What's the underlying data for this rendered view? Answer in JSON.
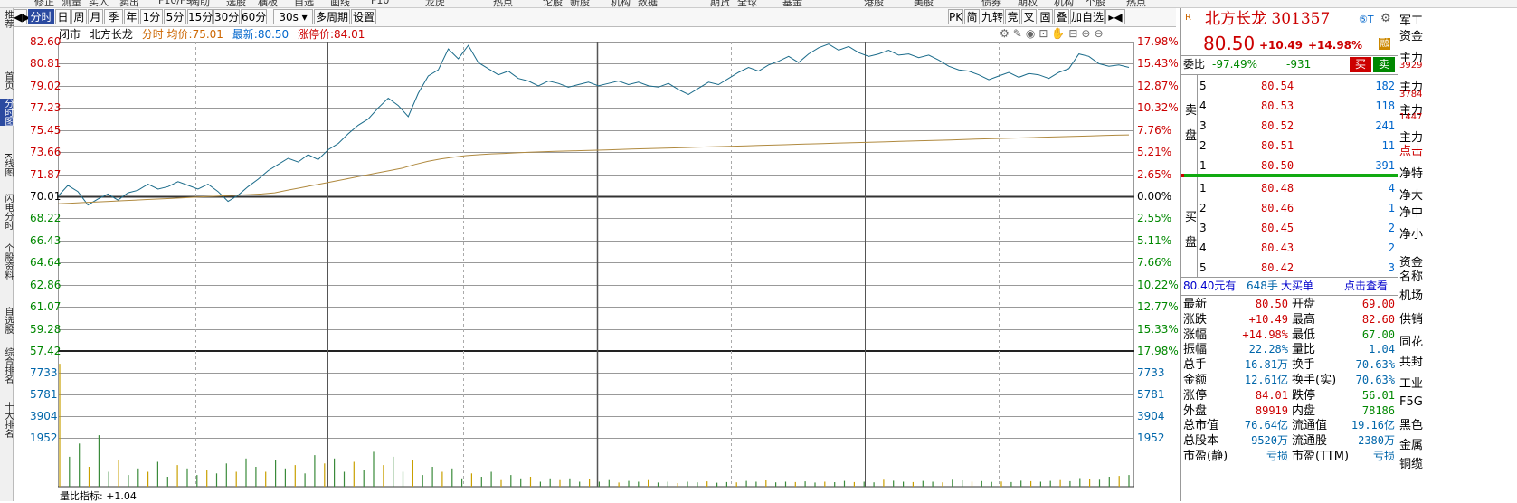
{
  "top_menu": [
    "修正",
    "测量",
    "买入",
    "卖出",
    "F10/F9",
    "陶助",
    "选股",
    "横板",
    "自选",
    "画线",
    "F10",
    "龙虎",
    "热点",
    "论股",
    "新股",
    "机构",
    "数据",
    "期货",
    "全球",
    "基金",
    "港股",
    "美股",
    "债券",
    "期权",
    "机构",
    "个股",
    "热点"
  ],
  "toolbar": {
    "tabs": [
      "分时",
      "日",
      "周",
      "月",
      "季",
      "年",
      "1分",
      "5分",
      "15分",
      "30分",
      "60分",
      "30s",
      "多周期",
      "设置"
    ],
    "right_buttons": [
      "PK",
      "简",
      "九转",
      "竞",
      "叉",
      "固",
      "叠",
      "加自选"
    ]
  },
  "sidebar": [
    "推荐",
    "首页",
    "分时图",
    "K线图",
    "闪电分时",
    "个股资料",
    "自选股",
    "综合排名",
    "十大排名"
  ],
  "chart_info": {
    "status": "闭市",
    "name": "北方长龙",
    "mode": "分时",
    "avg_label": "均价:",
    "avg_value": "75.01",
    "latest_label": "最新:",
    "latest_value": "80.50",
    "limit_label": "涨停价:",
    "limit_value": "84.01"
  },
  "price_axis_left": [
    "82.60",
    "80.81",
    "79.02",
    "77.23",
    "75.45",
    "73.66",
    "71.87",
    "70.01",
    "68.22",
    "66.43",
    "64.64",
    "62.86",
    "61.07",
    "59.28",
    "57.42"
  ],
  "price_axis_right": [
    "17.98%",
    "15.43%",
    "12.87%",
    "10.32%",
    "7.76%",
    "5.21%",
    "2.65%",
    "0.00%",
    "2.55%",
    "5.11%",
    "7.66%",
    "10.22%",
    "12.77%",
    "15.33%",
    "17.98%"
  ],
  "volume_axis_left": [
    "7733",
    "5781",
    "3904",
    "1952"
  ],
  "volume_axis_right": [
    "7733",
    "5781",
    "3904",
    "1952"
  ],
  "bottom_label": "量比指标: +1.04",
  "chart_data": {
    "type": "line",
    "y_range": [
      57.42,
      82.6
    ],
    "prev_close": 70.01,
    "price_series": [
      70.01,
      70.9,
      70.4,
      69.3,
      69.8,
      70.2,
      69.7,
      70.3,
      70.5,
      71.0,
      70.6,
      70.8,
      71.2,
      70.9,
      70.6,
      71.0,
      70.4,
      69.6,
      70.1,
      70.8,
      71.4,
      72.1,
      72.6,
      73.1,
      72.8,
      73.4,
      73.0,
      73.8,
      74.3,
      75.1,
      75.8,
      76.3,
      77.2,
      78.0,
      77.4,
      76.5,
      78.4,
      79.8,
      80.3,
      82.0,
      81.2,
      82.3,
      80.9,
      80.4,
      79.9,
      80.2,
      79.6,
      79.4,
      79.0,
      79.4,
      79.2,
      78.9,
      79.1,
      79.3,
      79.0,
      79.2,
      79.4,
      79.1,
      79.3,
      79.0,
      78.9,
      79.2,
      78.7,
      78.3,
      78.8,
      79.3,
      79.1,
      79.6,
      80.1,
      80.5,
      80.2,
      80.7,
      81.0,
      81.4,
      80.9,
      81.6,
      82.1,
      82.4,
      81.9,
      82.2,
      81.7,
      81.4,
      81.6,
      81.9,
      81.5,
      81.6,
      81.3,
      81.5,
      81.1,
      80.6,
      80.3,
      80.2,
      79.9,
      79.5,
      79.8,
      80.1,
      79.7,
      80.0,
      79.9,
      79.6,
      80.1,
      80.4,
      81.6,
      81.4,
      80.8,
      80.6,
      80.7,
      80.5
    ],
    "avg_series": [
      69.4,
      69.45,
      69.5,
      69.55,
      69.6,
      69.65,
      69.7,
      69.75,
      69.8,
      69.85,
      69.9,
      69.95,
      70.0,
      70.05,
      70.1,
      70.15,
      70.2,
      70.3,
      70.5,
      70.7,
      70.9,
      71.1,
      71.3,
      71.5,
      71.7,
      71.9,
      72.1,
      72.3,
      72.6,
      72.85,
      73.05,
      73.2,
      73.32,
      73.4,
      73.46,
      73.5,
      73.55,
      73.6,
      73.64,
      73.67,
      73.7,
      73.73,
      73.76,
      73.79,
      73.82,
      73.85,
      73.88,
      73.91,
      73.94,
      73.97,
      74.0,
      74.03,
      74.06,
      74.09,
      74.12,
      74.15,
      74.18,
      74.21,
      74.24,
      74.27,
      74.3,
      74.33,
      74.36,
      74.39,
      74.42,
      74.45,
      74.48,
      74.51,
      74.54,
      74.57,
      74.6,
      74.63,
      74.66,
      74.69,
      74.72,
      74.75,
      74.78,
      74.81,
      74.84,
      74.87,
      74.9,
      74.93,
      74.96,
      74.99,
      75.01
    ],
    "volume_range": [
      0,
      7733
    ],
    "volume_series": [
      7400,
      1800,
      2600,
      1200,
      3100,
      900,
      1600,
      700,
      1100,
      900,
      1500,
      600,
      1300,
      1100,
      700,
      1000,
      800,
      1400,
      900,
      1700,
      1200,
      900,
      1600,
      1100,
      1300,
      800,
      1900,
      1400,
      1700,
      900,
      1500,
      1000,
      2100,
      1300,
      1800,
      900,
      1600,
      700,
      1200,
      900,
      1100,
      500,
      800,
      600,
      900,
      400,
      700,
      500,
      600,
      300,
      500,
      400,
      500,
      300,
      450,
      300,
      400,
      250,
      350,
      300,
      400,
      250,
      300,
      220,
      300,
      260,
      320,
      240,
      280,
      260,
      350,
      300,
      380,
      260,
      300,
      280,
      320,
      250,
      300,
      270,
      350,
      280,
      300,
      260,
      420,
      360,
      300,
      280,
      350,
      300,
      260,
      420,
      380,
      300,
      340,
      290,
      310,
      280,
      360,
      330,
      300,
      350,
      400,
      330,
      520,
      480,
      420,
      600,
      650,
      700
    ]
  },
  "right_panel": {
    "stock_name": "北方长龙",
    "stock_code": "301357",
    "price": "80.50",
    "change": "+10.49",
    "change_pct": "+14.98%",
    "weibi_label": "委比",
    "weibi_value": "-97.49%",
    "weicha": "-931",
    "buy_btn": "买",
    "sell_btn": "卖",
    "sell_label": "卖盘",
    "buy_label": "买盘",
    "asks": [
      {
        "level": "5",
        "price": "80.54",
        "vol": "182"
      },
      {
        "level": "4",
        "price": "80.53",
        "vol": "118"
      },
      {
        "level": "3",
        "price": "80.52",
        "vol": "241"
      },
      {
        "level": "2",
        "price": "80.51",
        "vol": "11"
      },
      {
        "level": "1",
        "price": "80.50",
        "vol": "391"
      }
    ],
    "bids": [
      {
        "level": "1",
        "price": "80.48",
        "vol": "4"
      },
      {
        "level": "2",
        "price": "80.46",
        "vol": "1"
      },
      {
        "level": "3",
        "price": "80.45",
        "vol": "2"
      },
      {
        "level": "4",
        "price": "80.43",
        "vol": "2"
      },
      {
        "level": "5",
        "price": "80.42",
        "vol": "3"
      }
    ],
    "big_order_price": "80.40元有",
    "big_order_vol": "648手",
    "big_order_text": "大买单",
    "big_order_link": "点击查看",
    "stats": [
      {
        "l": "最新",
        "v": "80.50",
        "l2": "开盘",
        "v2": "69.00"
      },
      {
        "l": "涨跌",
        "v": "+10.49",
        "l2": "最高",
        "v2": "82.60"
      },
      {
        "l": "涨幅",
        "v": "+14.98%",
        "l2": "最低",
        "v2": "67.00"
      },
      {
        "l": "振幅",
        "v": "22.28%",
        "l2": "量比",
        "v2": "1.04"
      },
      {
        "l": "总手",
        "v": "16.81万",
        "l2": "换手",
        "v2": "70.63%"
      },
      {
        "l": "金额",
        "v": "12.61亿",
        "l2": "换手(实)",
        "v2": "70.63%"
      },
      {
        "l": "涨停",
        "v": "84.01",
        "l2": "跌停",
        "v2": "56.01"
      },
      {
        "l": "外盘",
        "v": "89919",
        "l2": "内盘",
        "v2": "78186"
      },
      {
        "l": "总市值",
        "v": "76.64亿",
        "l2": "流通值",
        "v2": "19.16亿"
      },
      {
        "l": "总股本",
        "v": "9520万",
        "l2": "流通股",
        "v2": "2380万"
      },
      {
        "l": "市盈(静)",
        "v": "亏损",
        "l2": "市盈(TTM)",
        "v2": "亏损"
      }
    ]
  },
  "edge_panel": [
    "军工",
    "资金",
    "主力",
    "3929",
    "主力",
    "3784",
    "主力",
    "1447",
    "主力",
    "点击",
    "净特",
    "净大",
    "净中",
    "净小",
    "资金",
    "名称",
    "机场",
    "供销",
    "同花",
    "共封",
    "工业",
    "F5G",
    "黑色",
    "金属",
    "铜缆"
  ]
}
